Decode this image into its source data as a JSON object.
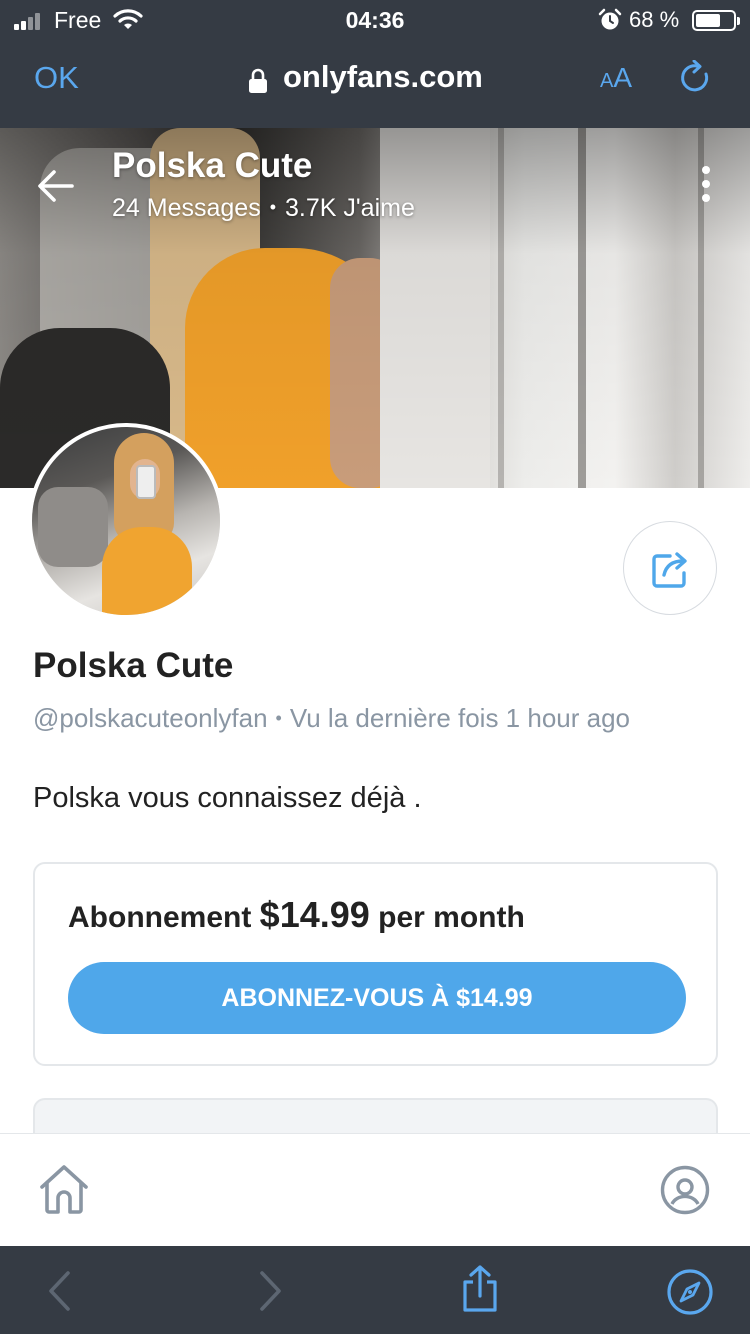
{
  "status_bar": {
    "carrier": "Free",
    "time": "04:36",
    "battery_percent": "68 %",
    "battery_level": 0.68,
    "icons": [
      "signal-icon",
      "wifi-icon",
      "alarm-icon",
      "battery-icon"
    ]
  },
  "browser": {
    "done_label": "OK",
    "domain": "onlyfans.com",
    "text_size_small": "A",
    "text_size_large": "A",
    "icons": [
      "lock-icon",
      "reload-icon"
    ]
  },
  "cover": {
    "title": "Polska Cute",
    "posts_count": "24 Messages",
    "separator": "•",
    "likes_count": "3.7K J'aime",
    "icons": [
      "back-arrow-icon",
      "more-vertical-icon"
    ]
  },
  "profile": {
    "name": "Polska Cute",
    "handle": "@polskacuteonlyfan",
    "separator": "•",
    "last_seen": "Vu la dernière fois 1 hour ago",
    "bio": "Polska vous connaissez déjà ."
  },
  "subscription": {
    "label": "Abonnement",
    "price": "$14.99",
    "period": "per month",
    "button_label": "ABONNEZ-VOUS À $14.99"
  },
  "app_nav": {
    "icons": [
      "home-icon",
      "profile-icon"
    ]
  },
  "safari_toolbar": {
    "icons": [
      "back-chevron-icon",
      "forward-chevron-icon",
      "share-icon",
      "compass-icon"
    ]
  },
  "colors": {
    "browser_chrome": "#353b44",
    "accent": "#4fa7ea",
    "muted_text": "#8a96a3",
    "border": "#e4e7ea"
  }
}
